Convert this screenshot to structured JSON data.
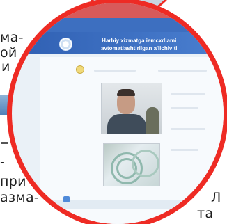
{
  "background_article": {
    "fragments": [
      "ма-",
      "ой",
      "и",
      "-",
      "при",
      "азма-",
      "Л",
      "та"
    ]
  },
  "website": {
    "top_banner": "",
    "nav_items": [],
    "header_title_line1": "Harbiy xizmatga iemcxdlami",
    "header_title_line2": "avtomatlashtirilgan a'lichiv ti",
    "photo_caption": "",
    "fingerprint_caption": "",
    "faint_right_text": []
  },
  "colors": {
    "lens_border": "#ee2b24",
    "header_blue": "#3d6fc0"
  },
  "icons": [
    "logo-emblem-icon",
    "status-dot-icon",
    "bottom-app-icon"
  ]
}
